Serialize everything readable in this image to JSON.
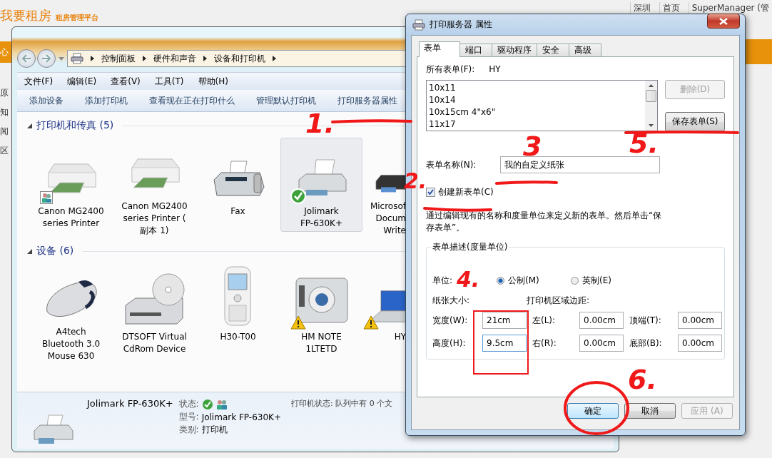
{
  "background_page": {
    "logo": "我要租房",
    "tagline": "租房管理平台",
    "nav_links": [
      "深圳",
      "首页",
      "SuperManager (管"
    ],
    "nav_tab": "心",
    "sidebar_items": [
      "原",
      "知",
      "闻",
      "区"
    ]
  },
  "explorer": {
    "breadcrumbs": [
      "控制面板",
      "硬件和声音",
      "设备和打印机"
    ],
    "menu": [
      "文件(F)",
      "编辑(E)",
      "查看(V)",
      "工具(T)",
      "帮助(H)"
    ],
    "commands": [
      "添加设备",
      "添加打印机",
      "查看现在正在打印什么",
      "管理默认打印机",
      "打印服务器属性"
    ],
    "sections": [
      {
        "title": "打印机和传真 (5)",
        "expanded": true,
        "items": [
          {
            "name": "Canon MG2400\nseries Printer",
            "kind": "mfp",
            "shared": true,
            "default_printer": false,
            "warning": false,
            "selected": false
          },
          {
            "name": "Canon MG2400\nseries Printer (\n副本 1)",
            "kind": "mfp",
            "shared": false,
            "default_printer": false,
            "warning": false,
            "selected": false
          },
          {
            "name": "Fax",
            "kind": "fax",
            "shared": false,
            "default_printer": false,
            "warning": false,
            "selected": false
          },
          {
            "name": "Jolimark\nFP-630K+",
            "kind": "printer",
            "shared": false,
            "default_printer": true,
            "warning": false,
            "selected": true
          },
          {
            "name": "Microsof\nDocum\nWrite",
            "kind": "xps",
            "shared": false,
            "default_printer": false,
            "warning": false,
            "selected": false
          }
        ]
      },
      {
        "title": "设备 (6)",
        "expanded": true,
        "items": [
          {
            "name": "A4tech\nBluetooth 3.0\nMouse 630",
            "kind": "mouse",
            "shared": false,
            "default_printer": false,
            "warning": false,
            "selected": false
          },
          {
            "name": "DTSOFT Virtual\nCdRom Device",
            "kind": "cdrom",
            "shared": false,
            "default_printer": false,
            "warning": false,
            "selected": false
          },
          {
            "name": "H30-T00",
            "kind": "phone",
            "shared": false,
            "default_printer": false,
            "warning": false,
            "selected": false
          },
          {
            "name": "HM NOTE\n1LTETD",
            "kind": "camera",
            "shared": false,
            "default_printer": false,
            "warning": true,
            "selected": false
          },
          {
            "name": "HY",
            "kind": "laptop",
            "shared": false,
            "default_printer": false,
            "warning": true,
            "selected": false
          }
        ]
      }
    ],
    "details": {
      "name": "Jolimark FP-630K+",
      "status_label": "状态:",
      "model_label": "型号:",
      "model": "Jolimark FP-630K+",
      "category_label": "类别:",
      "category": "打印机",
      "printer_status": "打印机状态: 队列中有 0 个文"
    }
  },
  "dialog": {
    "title": "打印服务器 属性",
    "tabs": [
      {
        "label": "表单",
        "selected": true
      },
      {
        "label": "端口",
        "selected": false
      },
      {
        "label": "驱动程序",
        "selected": false
      },
      {
        "label": "安全",
        "selected": false
      },
      {
        "label": "高级",
        "selected": false
      }
    ],
    "all_forms_label": "所有表单(F):",
    "all_forms_value": "HY",
    "forms": [
      "10x11",
      "10x14",
      "10x15cm 4\"x6\"",
      "11x17"
    ],
    "delete_button": {
      "label": "删除(D)",
      "disabled": true
    },
    "save_button": {
      "label": "保存表单(S)",
      "disabled": false
    },
    "form_name_label": "表单名称(N):",
    "form_name": "我的自定义纸张",
    "create_new": {
      "label": "创建新表单(C)",
      "checked": true
    },
    "description": "通过编辑现有的名称和度量单位来定义新的表单。然后单击“保存表单”。",
    "group_title": "表单描述(度量单位)",
    "units_label": "单位:",
    "units": [
      {
        "label": "公制(M)",
        "selected": true
      },
      {
        "label": "英制(E)",
        "selected": false
      }
    ],
    "paper_size_label": "纸张大小:",
    "margins_label": "打印机区域边距:",
    "fields": [
      {
        "label": "宽度(W):",
        "value": "21cm"
      },
      {
        "label": "左(L):",
        "value": "0.00cm"
      },
      {
        "label": "顶端(T):",
        "value": "0.00cm"
      },
      {
        "label": "高度(H):",
        "value": "9.5cm"
      },
      {
        "label": "右(R):",
        "value": "0.00cm"
      },
      {
        "label": "底部(B):",
        "value": "0.00cm"
      }
    ],
    "buttons": [
      {
        "label": "确定",
        "default": true,
        "disabled": false
      },
      {
        "label": "取消",
        "default": false,
        "disabled": false
      },
      {
        "label": "应用 (A)",
        "default": false,
        "disabled": true
      }
    ]
  },
  "annotations": [
    {
      "label": "1."
    },
    {
      "label": "2."
    },
    {
      "label": "3"
    },
    {
      "label": "4."
    },
    {
      "label": "5."
    },
    {
      "label": "6."
    }
  ]
}
